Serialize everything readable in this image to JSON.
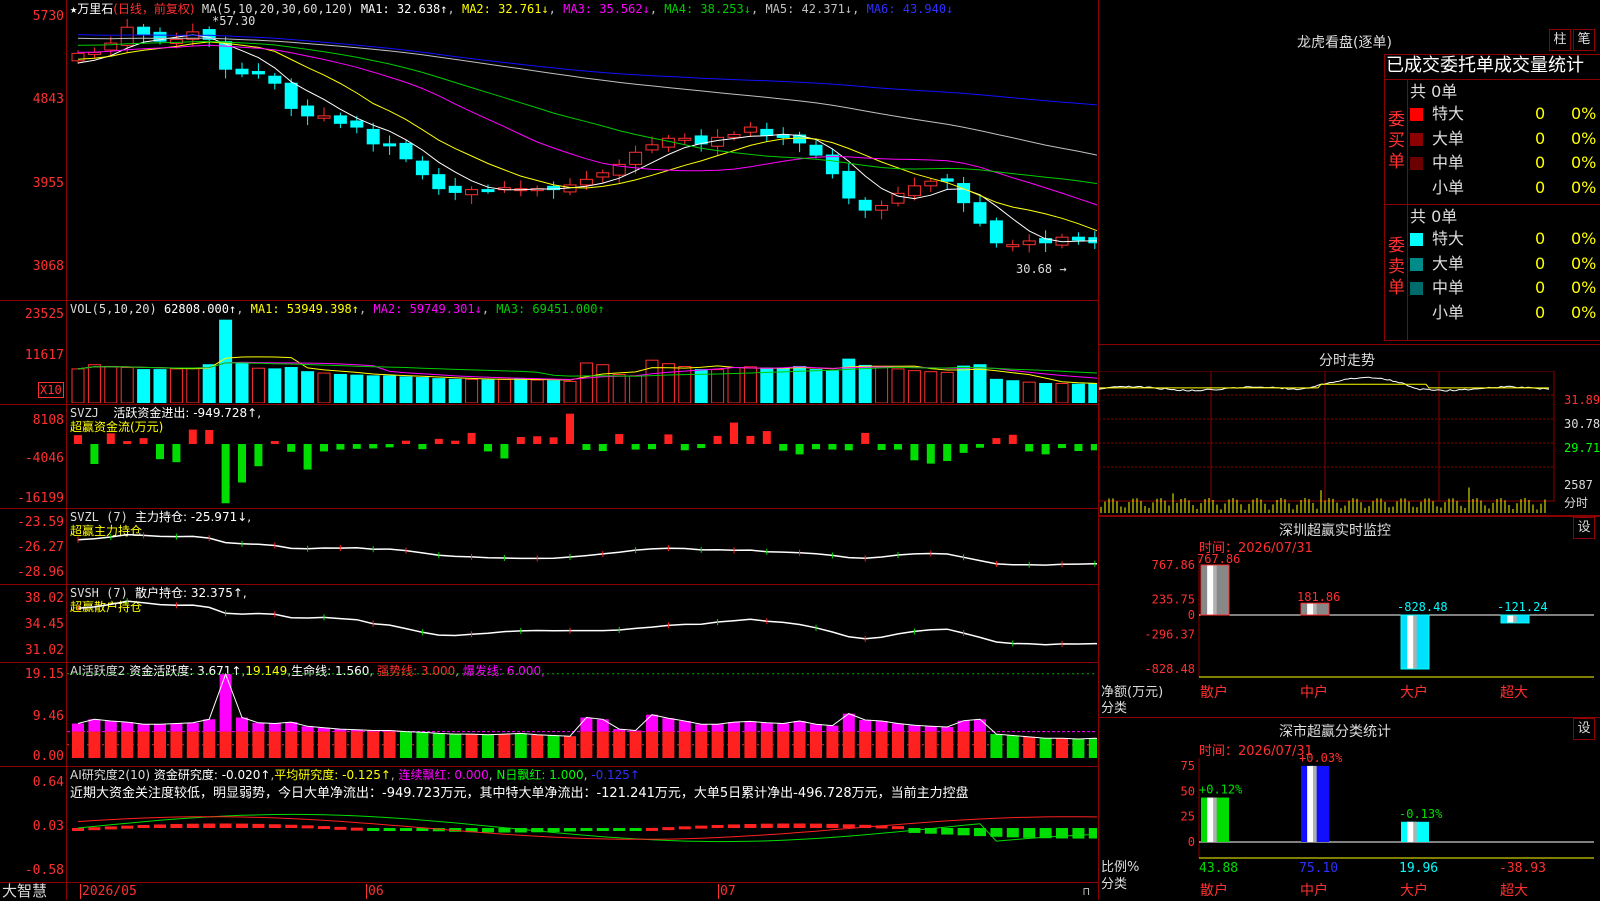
{
  "stock": {
    "star": "★",
    "name": "万里石",
    "period": "(日线，前复权)"
  },
  "colors": {
    "up": "#ff3030",
    "down": "#00ffff",
    "ma1": "#ffffff",
    "ma2": "#ffff00",
    "ma3": "#ff00ff",
    "ma4": "#00cc00",
    "ma5": "#c0c0c0",
    "ma6": "#1010ff"
  },
  "chart_data": [
    {
      "type": "candlestick",
      "title": "MA(5,10,20,30,60,120)",
      "ma_labels": [
        "MA1: 32.638↑",
        "MA2: 32.761↓",
        "MA3: 35.562↓",
        "MA4: 38.253↓",
        "MA5: 42.371↓",
        "MA6: 43.940↓"
      ],
      "ylim": [
        2850,
        5850
      ],
      "y_ticks": [
        "5730",
        "4843",
        "3955",
        "3068"
      ],
      "annotations": {
        "high": "57.30",
        "low": "30.68"
      },
      "closes": [
        5450,
        5460,
        5560,
        5730,
        5650,
        5580,
        5600,
        5680,
        5600,
        5280,
        5230,
        5230,
        5130,
        4860,
        4780,
        4780,
        4700,
        4660,
        4480,
        4460,
        4320,
        4150,
        4000,
        3960,
        3990,
        3980,
        4010,
        4000,
        4000,
        3990,
        4040,
        4100,
        4170,
        4260,
        4390,
        4470,
        4540,
        4540,
        4480,
        4550,
        4580,
        4660,
        4570,
        4550,
        4490,
        4360,
        4160,
        3900,
        3770,
        3820,
        3950,
        4030,
        4080,
        4080,
        3850,
        3630,
        3420,
        3400,
        3440,
        3420,
        3480,
        3450,
        3420,
        3350,
        3340
      ],
      "volume": {
        "title": "VOL(5,10,20)",
        "labels": [
          "62808.000↑",
          "MA1: 53949.398↑",
          "MA2: 59749.301↓",
          "MA3: 69451.000↑"
        ],
        "y_ticks": [
          "23525",
          "11617"
        ],
        "unit": "X10",
        "values": [
          9800,
          11000,
          10500,
          10200,
          9600,
          9600,
          9800,
          10000,
          11000,
          23800,
          11500,
          10000,
          9800,
          10200,
          9000,
          8600,
          8200,
          8000,
          7800,
          7800,
          7500,
          7300,
          7000,
          6800,
          6800,
          6600,
          6800,
          7000,
          6600,
          6400,
          6200,
          11500,
          11000,
          8200,
          7800,
          12300,
          11300,
          10500,
          9600,
          9600,
          10200,
          10400,
          10000,
          9800,
          10500,
          9600,
          9200,
          12600,
          10800,
          10500,
          9800,
          9300,
          9000,
          8800,
          10600,
          11000,
          6800,
          6400,
          6000,
          5600,
          5600,
          5400,
          5600,
          5400,
          5800
        ]
      },
      "svzj": {
        "title": "SVZJ",
        "label": "活跃资金进出: -949.728↑,",
        "sublabel": "超赢资金流(万元)",
        "y_ticks": [
          "8108",
          "-4046",
          "-16199"
        ],
        "values": [
          2400,
          -5400,
          2900,
          800,
          1600,
          -4100,
          -4900,
          3900,
          3800,
          -16000,
          -10400,
          -6000,
          800,
          -2100,
          -6900,
          -2000,
          -1500,
          -1300,
          -1200,
          -900,
          900,
          -1400,
          1400,
          900,
          3000,
          -2000,
          -3900,
          1900,
          2100,
          1800,
          8200,
          -1600,
          -1900,
          2700,
          -1500,
          -1400,
          2600,
          -1700,
          -1100,
          2200,
          5800,
          2200,
          3500,
          -1800,
          -2800,
          -1400,
          -1500,
          -1700,
          3000,
          -1600,
          -1500,
          -4400,
          -5300,
          -4600,
          -2400,
          -1000,
          1600,
          2500,
          -2000,
          -2800,
          -1100,
          -1900,
          -1700,
          -1300,
          -5500,
          -1400,
          -1500,
          -1300,
          -1200,
          -1400,
          -900,
          -1700,
          -1400,
          -1200,
          -1100,
          -1300,
          -1300,
          -1200,
          -1100,
          -1000
        ]
      },
      "svzl": {
        "title": "SVZL (7)",
        "label": "主力持仓: -25.971↓,",
        "sublabel": "超赢主力持仓",
        "y_ticks": [
          "-23.59",
          "-26.27",
          "-28.96"
        ]
      },
      "svsh": {
        "title": "SVSH (7)",
        "label": "散户持仓: 32.375↑,",
        "sublabel": "超赢散户持仓",
        "y_ticks": [
          "38.02",
          "34.45",
          "31.02"
        ]
      },
      "ai_active": {
        "title": "AI活跃度2",
        "labels": [
          "资金活跃度: 3.671↑",
          "19.149",
          "生命线: 1.560",
          "强势线: 3.000",
          "爆发线: 6.000,"
        ],
        "y_ticks": [
          "19.15",
          "9.46",
          "0.00"
        ]
      },
      "ai_research": {
        "title": "AI研究度2(10)",
        "labels": [
          "资金研究度: -0.020↑",
          "平均研究度: -0.125↑",
          "连续飘红: 0.000",
          "N日飘红: 1.000",
          "-0.125↑"
        ],
        "y_ticks": [
          "0.64",
          "0.03",
          "-0.58"
        ],
        "comment": "近期大资金关注度较低，明显弱势，今日大单净流出：-949.723万元，其中特大单净流出：-121.241万元，大单5日累计净出-496.728万元，当前主力控盘"
      }
    },
    {
      "type": "bar",
      "title": "深圳超赢实时监控",
      "date_label": "时间：2026/07/31",
      "categories": [
        "散户",
        "中户",
        "大户",
        "超大"
      ],
      "values": [
        767.86,
        181.86,
        -828.48,
        -121.24
      ],
      "labels": [
        "767.86",
        "181.86",
        "-828.48",
        "-121.24"
      ],
      "y_ticks": [
        "767.86",
        "235.75",
        "0",
        "-296.37",
        "-828.48"
      ],
      "ylabel": "净额(万元)",
      "xlabel": "分类"
    },
    {
      "type": "bar",
      "title": "深市超赢分类统计",
      "date_label": "时间：2026/07/31",
      "categories": [
        "散户",
        "中户",
        "大户",
        "超大"
      ],
      "values": [
        43.88,
        75.1,
        19.96,
        -38.93
      ],
      "pct_labels": [
        "+0.12%",
        "+0.03%",
        "-0.13%",
        ""
      ],
      "value_labels": [
        "43.88",
        "75.10",
        "19.96",
        "-38.93"
      ],
      "y_ticks": [
        "75",
        "50",
        "25",
        "0"
      ],
      "ylabel": "比例%",
      "xlabel": "分类"
    }
  ],
  "x_axis": {
    "labels": [
      "2026/05",
      "06",
      "07"
    ]
  },
  "brand": "大智慧",
  "dragon_tiger": {
    "title": "龙虎看盘(逐单)",
    "btn_col": "柱",
    "btn_line": "笔",
    "heading": "已成交委托单成交量统计",
    "buy": {
      "label": "委买单",
      "total": "共 0单",
      "rows": [
        {
          "name": "特大",
          "count": "0",
          "pct": "0%",
          "color": "#ff0000"
        },
        {
          "name": "大单",
          "count": "0",
          "pct": "0%",
          "color": "#8b0000"
        },
        {
          "name": "中单",
          "count": "0",
          "pct": "0%",
          "color": "#6b0000"
        },
        {
          "name": "小单",
          "count": "0",
          "pct": "0%",
          "color": ""
        }
      ]
    },
    "sell": {
      "label": "委卖单",
      "total": "共 0单",
      "rows": [
        {
          "name": "特大",
          "count": "0",
          "pct": "0%",
          "color": "#00ffff"
        },
        {
          "name": "大单",
          "count": "0",
          "pct": "0%",
          "color": "#008b8b"
        },
        {
          "name": "中单",
          "count": "0",
          "pct": "0%",
          "color": "#006b6b"
        },
        {
          "name": "小单",
          "count": "0",
          "pct": "0%",
          "color": ""
        }
      ]
    }
  },
  "intraday": {
    "title": "分时走势",
    "price_labels": [
      "31.89",
      "30.78",
      "29.71"
    ],
    "vol_labels": [
      "2587",
      "分时"
    ]
  },
  "settings_label": "设"
}
